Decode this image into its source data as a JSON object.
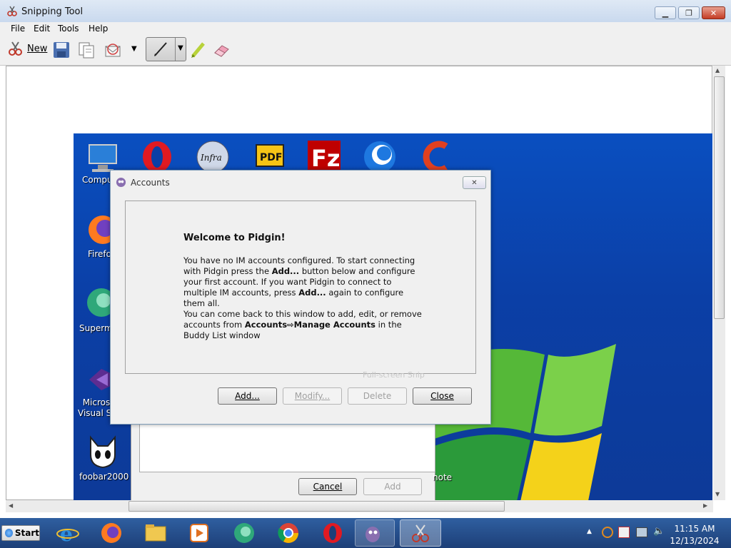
{
  "window": {
    "title": "Snipping Tool"
  },
  "menu": [
    "File",
    "Edit",
    "Tools",
    "Help"
  ],
  "toolbar": {
    "new_label": "New"
  },
  "desktop_icons": [
    {
      "label": "Compu",
      "icon": "computer-icon"
    },
    {
      "label": "Firefo",
      "icon": "firefox-icon"
    },
    {
      "label": "Superm",
      "icon": "supermium-icon"
    },
    {
      "label": "Micros\nVisual St",
      "icon": "visual-studio-icon"
    },
    {
      "label": "foobar2000",
      "icon": "foobar-icon"
    }
  ],
  "dialog": {
    "title": "Accounts",
    "heading": "Welcome to Pidgin!",
    "para1_a": "You have no IM accounts configured. To start connecting with Pidgin press the ",
    "para1_b": "Add...",
    "para1_c": " button below and configure your first account. If you want Pidgin to connect to multiple IM accounts, press ",
    "para1_d": "Add...",
    "para1_e": " again to configure them all.",
    "para2_a": "You can come back to this window to add, edit, or remove accounts from ",
    "para2_b": "Accounts⇨Manage Accounts",
    "para2_c": " in the Buddy List window",
    "ghost_text": "Full-screen Snip",
    "buttons": {
      "add": "Add...",
      "modify": "Modify...",
      "delete": "Delete",
      "close": "Close"
    }
  },
  "back_dialog": {
    "cancel": "Cancel",
    "add": "Add"
  },
  "desktop_right_label": "note",
  "taskbar": {
    "start": "Start",
    "time": "11:15 AM",
    "date": "12/13/2024"
  }
}
